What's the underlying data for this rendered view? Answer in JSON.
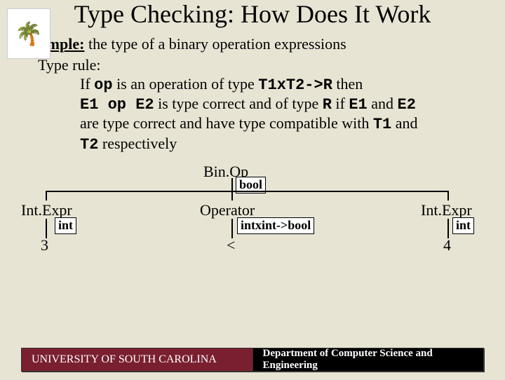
{
  "title": "Type Checking: How Does It Work",
  "example": {
    "label": "Example:",
    "text": " the type of a binary operation expressions"
  },
  "rule": {
    "heading": "Type rule:",
    "l1a": "If ",
    "l1op": "op",
    "l1b": " is an operation of type ",
    "l1type": "T1xT2->R",
    "l1c": " then",
    "l2a": "E1 op E2",
    "l2b": " is type correct and of type ",
    "l2r": "R",
    "l2c": " if ",
    "l2e1": "E1",
    "l2d": " and ",
    "l2e2": "E2",
    "l3a": "are type correct and have  type compatible with ",
    "l3t1": "T1",
    "l3b": " and",
    "l4t2": "T2",
    "l4a": " respectively"
  },
  "tree": {
    "root": "Bin.Op",
    "root_tag": "bool",
    "left": "Int.Expr",
    "left_tag": "int",
    "left_leaf": "3",
    "mid": "Operator",
    "mid_tag": "intxint->bool",
    "mid_leaf": "<",
    "right": "Int.Expr",
    "right_tag": "int",
    "right_leaf": "4"
  },
  "footer": {
    "left": "UNIVERSITY OF SOUTH CAROLINA",
    "right": "Department of Computer Science and Engineering"
  },
  "chart_data": {
    "type": "tree",
    "root": {
      "label": "Bin.Op",
      "annot": "bool"
    },
    "children": [
      {
        "label": "Int.Expr",
        "annot": "int",
        "child": "3"
      },
      {
        "label": "Operator",
        "annot": "intxint->bool",
        "child": "<"
      },
      {
        "label": "Int.Expr",
        "annot": "int",
        "child": "4"
      }
    ]
  }
}
